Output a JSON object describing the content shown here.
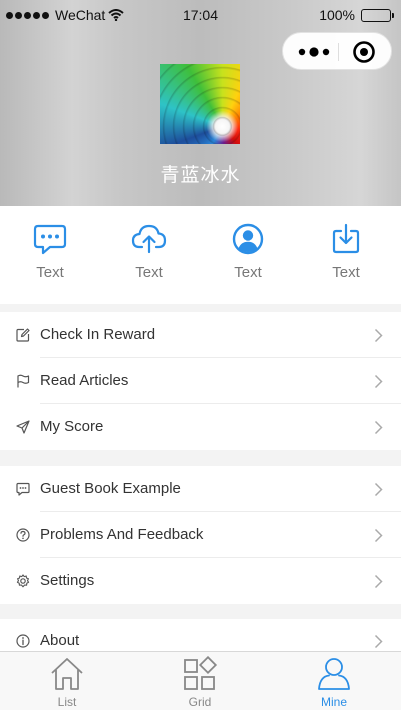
{
  "status_bar": {
    "carrier": "WeChat",
    "time": "17:04",
    "battery": "100%",
    "battery_level": 1.0,
    "icons": [
      "signal-dots-icon",
      "wifi-icon",
      "battery-icon"
    ]
  },
  "capsule": {
    "icons": [
      "more-icon",
      "close-target-icon"
    ]
  },
  "profile": {
    "name": "青蓝冰水",
    "avatar_icon": "rainbow-swirl-avatar"
  },
  "quick_actions": [
    {
      "label": "Text",
      "icon": "chat-bubble-icon"
    },
    {
      "label": "Text",
      "icon": "cloud-upload-icon"
    },
    {
      "label": "Text",
      "icon": "user-circle-icon"
    },
    {
      "label": "Text",
      "icon": "download-icon"
    }
  ],
  "menu_groups": [
    [
      {
        "label": "Check In Reward",
        "icon": "edit-icon"
      },
      {
        "label": "Read Articles",
        "icon": "flag-icon"
      },
      {
        "label": "My Score",
        "icon": "send-icon"
      }
    ],
    [
      {
        "label": "Guest Book Example",
        "icon": "message-icon"
      },
      {
        "label": "Problems And Feedback",
        "icon": "help-circle-icon"
      },
      {
        "label": "Settings",
        "icon": "gear-icon"
      }
    ],
    [
      {
        "label": "About",
        "icon": "info-icon"
      }
    ]
  ],
  "tab_bar": {
    "items": [
      {
        "label": "List",
        "icon": "home-icon",
        "active": false
      },
      {
        "label": "Grid",
        "icon": "grid-icon",
        "active": false
      },
      {
        "label": "Mine",
        "icon": "user-icon",
        "active": true
      }
    ]
  },
  "colors": {
    "accent": "#2b8ee6",
    "text": "#333333",
    "muted": "#777777",
    "background": "#f3f3f3"
  }
}
